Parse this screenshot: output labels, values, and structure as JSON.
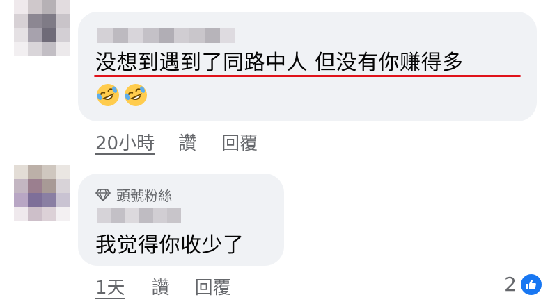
{
  "comments": [
    {
      "text": "没想到遇到了同路中人 但没有你赚得多",
      "emojis": [
        "rolling-on-floor-laughing",
        "rolling-on-floor-laughing"
      ],
      "actions": {
        "time": "20小時",
        "like": "讚",
        "reply": "回覆"
      },
      "highlight_color": "#e0121a"
    },
    {
      "badge": "頭號粉絲",
      "text": "我觉得你收少了",
      "actions": {
        "time": "1天",
        "like": "讚",
        "reply": "回覆"
      },
      "reactions": {
        "count": "2",
        "type": "like"
      }
    }
  ],
  "colors": {
    "bubble": "#f0f2f5",
    "secondary_text": "#65676b",
    "like_blue": "#1877f2"
  }
}
